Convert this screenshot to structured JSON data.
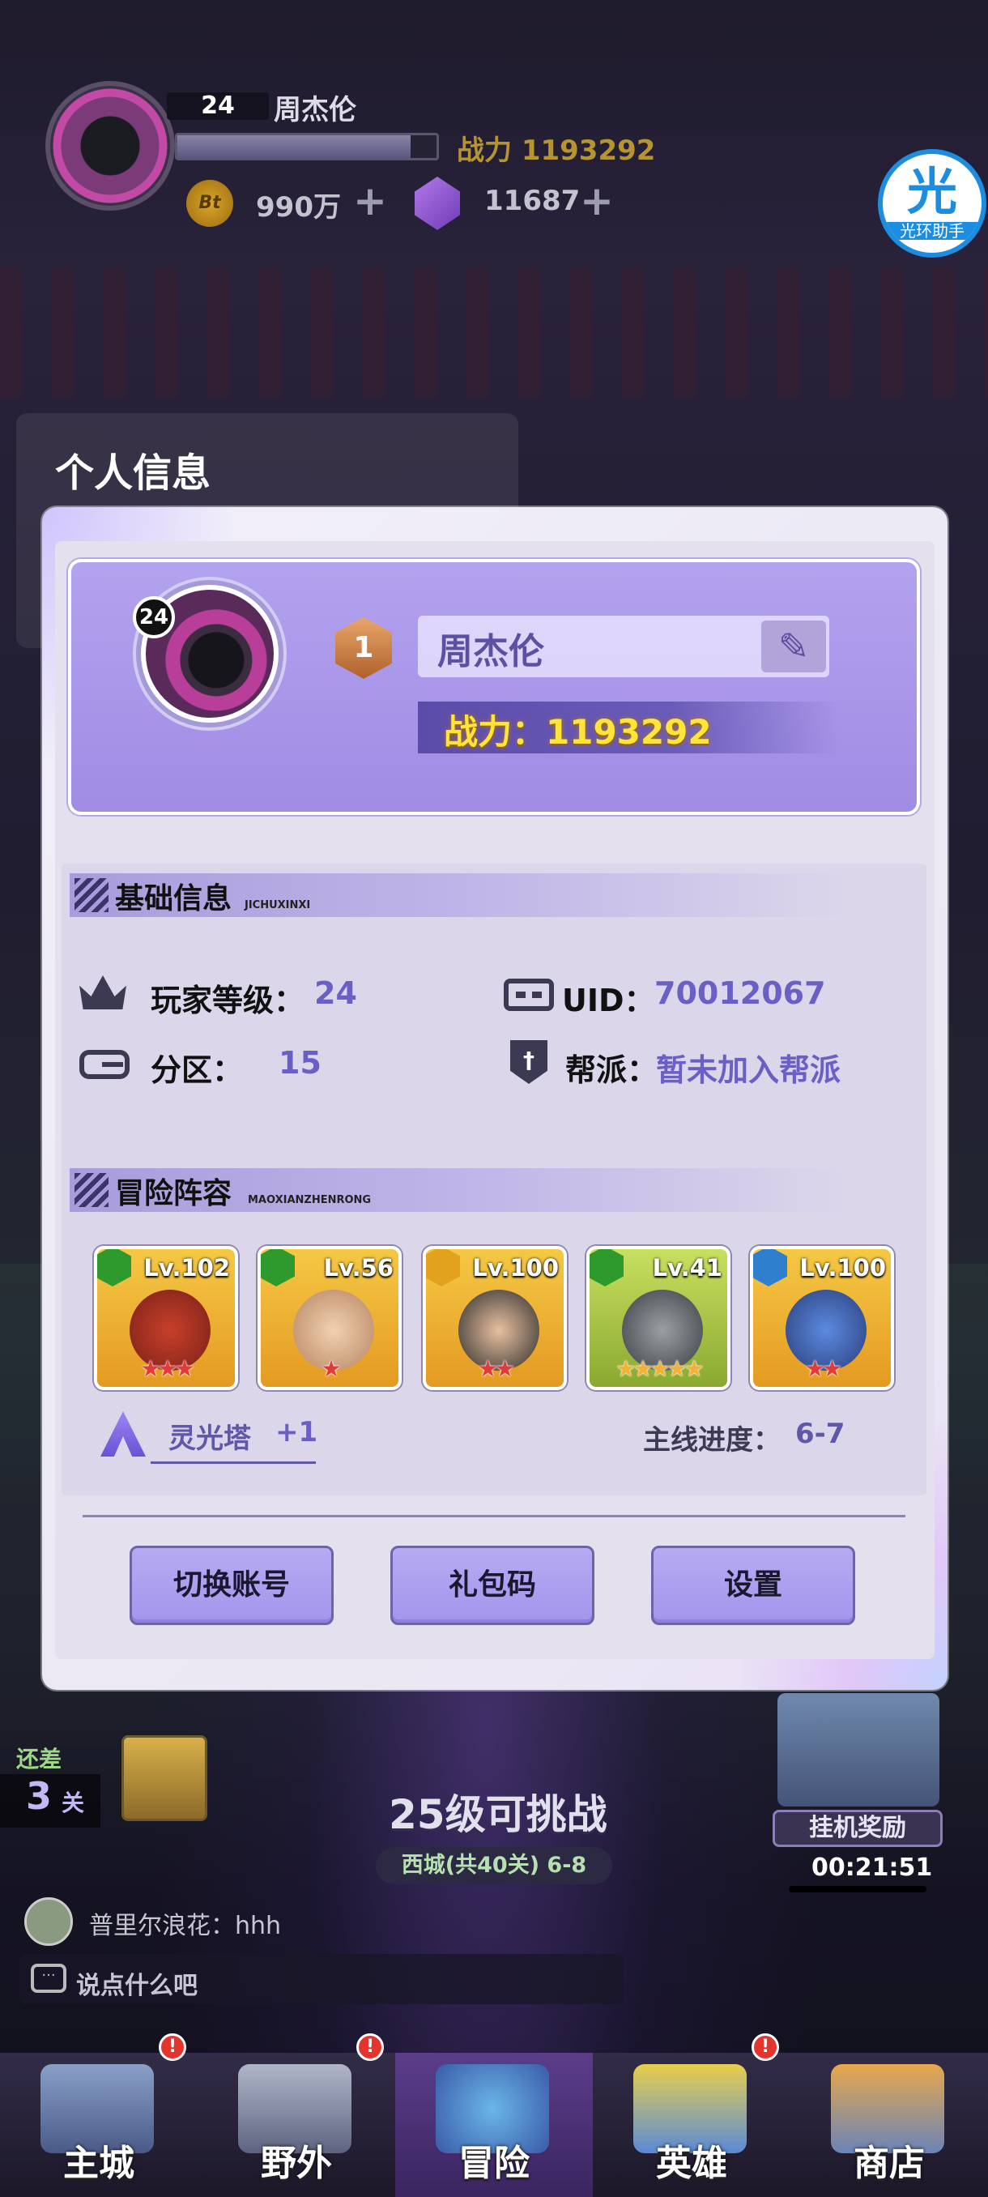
{
  "hud": {
    "level": "24",
    "name": "周杰伦",
    "exp_fraction": 0.9,
    "power": "战力 1193292",
    "coin_icon": "Bt",
    "coins": "990万",
    "gems": "11687",
    "plus": "+",
    "helper_glyph": "光",
    "helper_label": "光环助手"
  },
  "page_title": "个人信息",
  "profile": {
    "level_badge": "24",
    "rank": "1",
    "name": "周杰伦",
    "edit_icon": "edit-pen-icon",
    "power": "战力：1193292"
  },
  "basic": {
    "title": "基础信息",
    "subtitle": "JICHUXINXI",
    "player_level_label": "玩家等级：",
    "player_level": "24",
    "uid_label": "UID：",
    "uid": "70012067",
    "server_label": "分区：",
    "server": "15",
    "guild_label": "帮派：",
    "guild": "暂未加入帮派"
  },
  "lineup": {
    "title": "冒险阵容",
    "subtitle": "MAOXIANZHENRONG",
    "heroes": [
      {
        "level": "Lv.102",
        "element": "wood",
        "stars": 3
      },
      {
        "level": "Lv.56",
        "element": "wood",
        "stars": 1
      },
      {
        "level": "Lv.100",
        "element": "light",
        "stars": 2
      },
      {
        "level": "Lv.41",
        "element": "wood",
        "stars": 5
      },
      {
        "level": "Lv.100",
        "element": "water",
        "stars": 2
      }
    ],
    "tower_label": "灵光塔",
    "tower_value": "+1",
    "progress_label": "主线进度：",
    "progress_value": "6-7"
  },
  "buttons": {
    "switch_account": "切换账号",
    "gift_code": "礼包码",
    "settings": "设置"
  },
  "bottom": {
    "gap_label": "还差",
    "gap_num": "3",
    "gap_unit": "关",
    "challenge": "25级可挑战",
    "stage": "西城(共40关) 6-8",
    "afk_label": "挂机奖励",
    "afk_time": "00:21:51",
    "chat_msg": "普里尔浪花：hhh",
    "chat_placeholder": "说点什么吧"
  },
  "nav": {
    "badge": "!",
    "items": [
      "主城",
      "野外",
      "冒险",
      "英雄",
      "商店"
    ]
  },
  "colors": {
    "accent": "#6a5fc4",
    "power_yellow": "#ffe43a",
    "button_purple": "#a99cf0"
  }
}
